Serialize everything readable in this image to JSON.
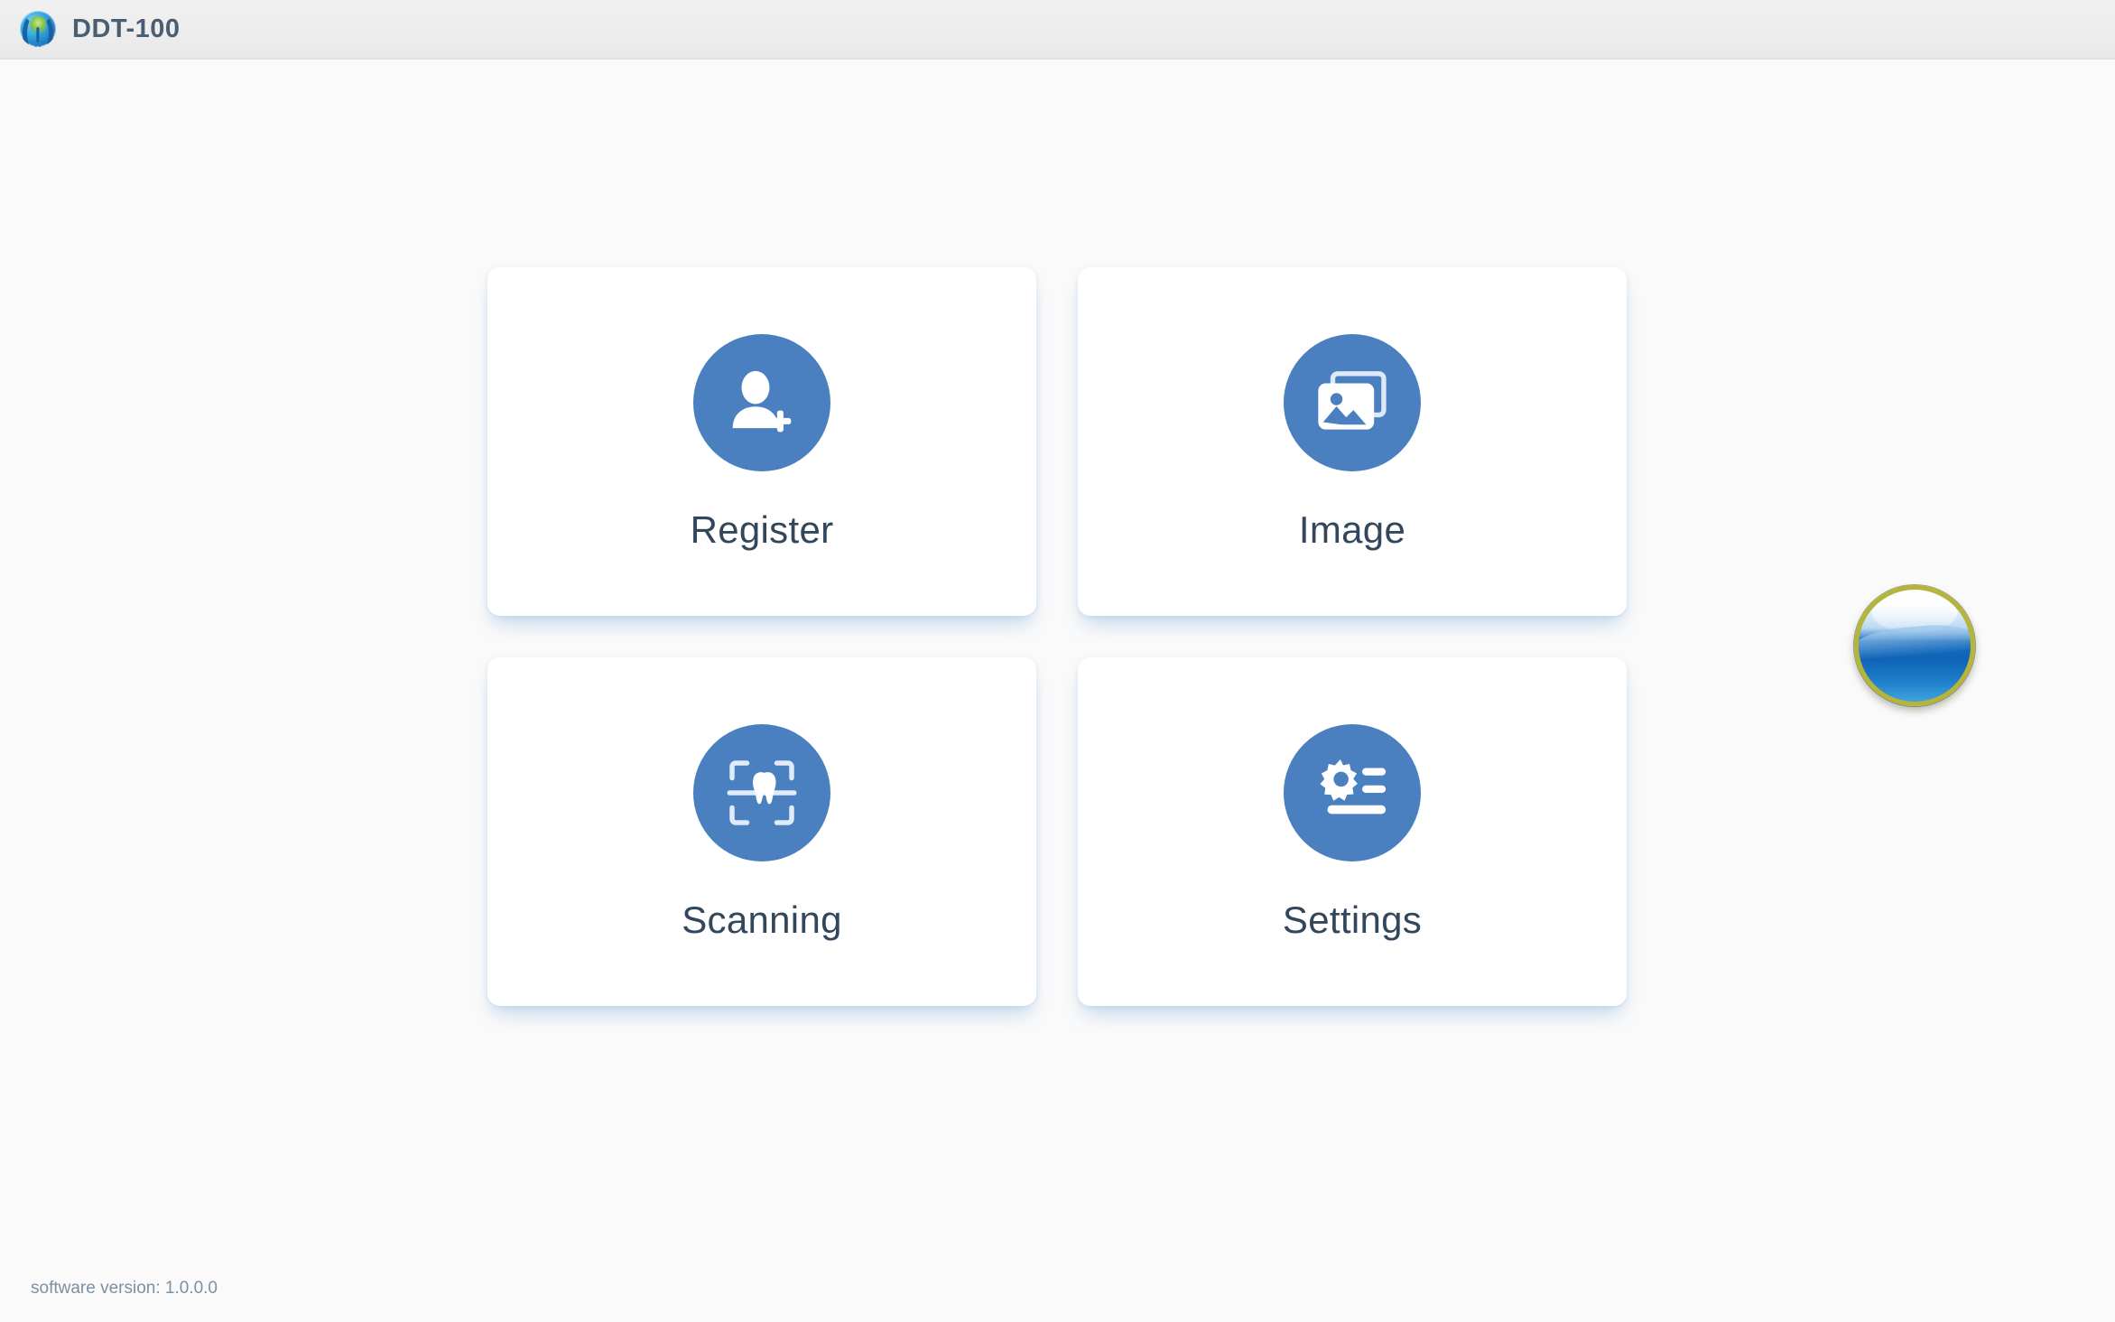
{
  "window": {
    "title": "DDT-100",
    "logo_icon": "ddt-emblem-icon",
    "titlebar_color": "#ededed",
    "background_color": "#fafafa"
  },
  "theme": {
    "accent": "#4a7fc0",
    "label_color": "#32475c",
    "title_color": "#4a5e72",
    "card_color": "#ffffff",
    "shadow_color": "#96b9e4",
    "footer_color": "#7d8fa3"
  },
  "main": {
    "tiles": [
      {
        "id": "register",
        "label": "Register",
        "icon": "user-add-icon"
      },
      {
        "id": "image",
        "label": "Image",
        "icon": "picture-icon"
      },
      {
        "id": "scanning",
        "label": "Scanning",
        "icon": "tooth-scan-icon"
      },
      {
        "id": "settings",
        "label": "Settings",
        "icon": "gear-list-icon"
      }
    ]
  },
  "status_orb": {
    "icon": "status-orb-icon",
    "ring_color": "#b5b53a",
    "fill_color": "#0f63b7"
  },
  "footer": {
    "version_text": "software version: 1.0.0.0"
  }
}
